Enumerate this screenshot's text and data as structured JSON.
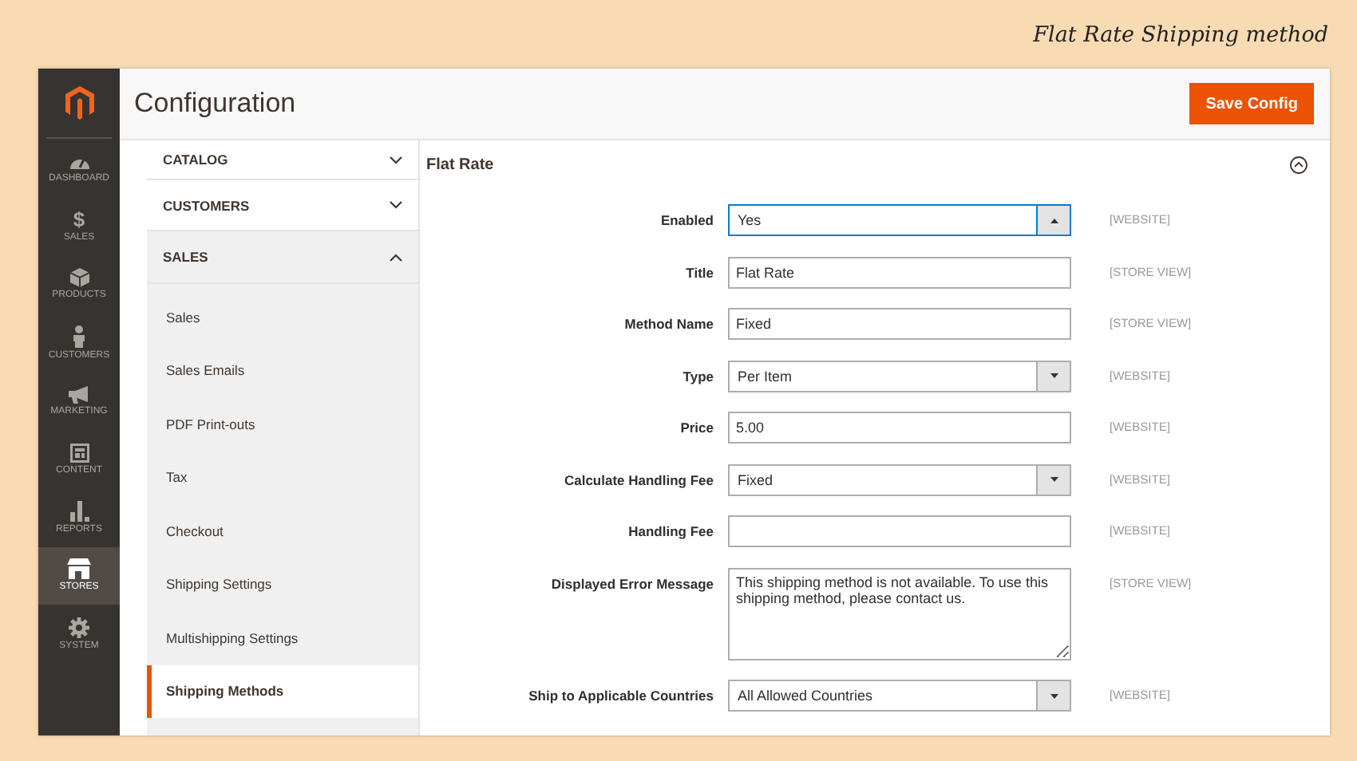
{
  "caption": "Flat Rate Shipping method",
  "nav": [
    {
      "label": "DASHBOARD",
      "kind": "gauge",
      "selected": false
    },
    {
      "label": "SALES",
      "kind": "glyph",
      "glyph": "$",
      "selected": false
    },
    {
      "label": "PRODUCTS",
      "kind": "box",
      "selected": false
    },
    {
      "label": "CUSTOMERS",
      "kind": "person",
      "selected": false
    },
    {
      "label": "MARKETING",
      "kind": "megaphone",
      "selected": false
    },
    {
      "label": "CONTENT",
      "kind": "layout",
      "selected": false
    },
    {
      "label": "REPORTS",
      "kind": "bars",
      "selected": false
    },
    {
      "label": "STORES",
      "kind": "store",
      "selected": true
    },
    {
      "label": "SYSTEM",
      "kind": "gear",
      "selected": false
    }
  ],
  "page_title": "Configuration",
  "save_button": "Save Config",
  "sections": [
    {
      "label": "CATALOG",
      "expanded": false
    },
    {
      "label": "CUSTOMERS",
      "expanded": false
    },
    {
      "label": "SALES",
      "expanded": true,
      "children": [
        {
          "label": "Sales",
          "selected": false
        },
        {
          "label": "Sales Emails",
          "selected": false
        },
        {
          "label": "PDF Print-outs",
          "selected": false
        },
        {
          "label": "Tax",
          "selected": false
        },
        {
          "label": "Checkout",
          "selected": false
        },
        {
          "label": "Shipping Settings",
          "selected": false
        },
        {
          "label": "Multishipping Settings",
          "selected": false
        },
        {
          "label": "Shipping Methods",
          "selected": true
        }
      ]
    }
  ],
  "group": {
    "title": "Flat Rate",
    "expanded": true
  },
  "fields": [
    {
      "label": "Enabled",
      "kind": "select",
      "value": "Yes",
      "scope": "[WEBSITE]",
      "focused": true
    },
    {
      "label": "Title",
      "kind": "text",
      "value": "Flat Rate",
      "scope": "[STORE VIEW]",
      "focused": false
    },
    {
      "label": "Method Name",
      "kind": "text",
      "value": "Fixed",
      "scope": "[STORE VIEW]",
      "focused": false
    },
    {
      "label": "Type",
      "kind": "select",
      "value": "Per Item",
      "scope": "[WEBSITE]",
      "focused": false
    },
    {
      "label": "Price",
      "kind": "text",
      "value": "5.00",
      "scope": "[WEBSITE]",
      "focused": false
    },
    {
      "label": "Calculate Handling Fee",
      "kind": "select",
      "value": "Fixed",
      "scope": "[WEBSITE]",
      "focused": false
    },
    {
      "label": "Handling Fee",
      "kind": "text",
      "scope": "[WEBSITE]",
      "focused": false
    },
    {
      "label": "Displayed Error Message",
      "kind": "textarea",
      "value": "This shipping method is not available. To use this shipping method, please contact us.",
      "scope": "[STORE VIEW]",
      "focused": false
    },
    {
      "label": "Ship to Applicable Countries",
      "kind": "select",
      "value": "All Allowed Countries",
      "scope": "[WEBSITE]",
      "focused": false
    }
  ]
}
